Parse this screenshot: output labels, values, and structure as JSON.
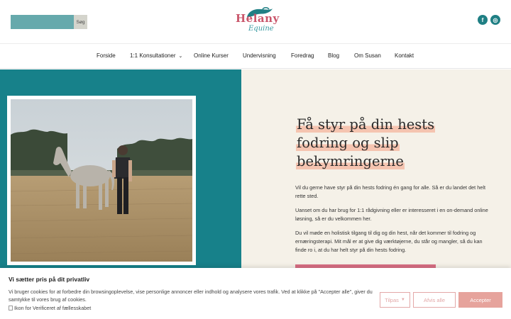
{
  "search": {
    "placeholder": "",
    "button_label": "Søg"
  },
  "logo": {
    "line1": "Helany",
    "line2": "Equine"
  },
  "social": [
    {
      "icon": "facebook-icon",
      "glyph": "f"
    },
    {
      "icon": "instagram-icon",
      "glyph": "◎"
    }
  ],
  "nav": {
    "items": [
      "Forside",
      "1:1 Konsultationer",
      "Online Kurser",
      "Undervisning",
      "Foredrag",
      "Blog",
      "Om Susan",
      "Kontakt"
    ]
  },
  "hero": {
    "title_lines": [
      "Få styr på din hests",
      "fodring og slip",
      "bekymringerne"
    ],
    "paragraphs": [
      "Vil du gerne have styr på din hests fodring én gang for alle. Så er du landet det helt rette sted.",
      "Uanset om du har brug for 1:1 rådgivning eller er interesseret i en on-demand online løsning, så er du velkommen her.",
      "Du vil møde en holistisk tilgang til dig og din hest, når det kommer til fodring og ernæringsterapi. Mit mål er at give dig værktøjerne, du står og mangler, så du kan finde ro i, at du har helt styr på din hests fodring."
    ]
  },
  "cookie": {
    "title": "Vi sætter pris på dit privatliv",
    "text": "Vi bruger cookies for at forbedre din browsingoplevelse, vise personlige annoncer eller indhold og analysere vores trafik. Ved at klikke på \"Accepter alle\", giver du samtykke til vores brug af cookies.",
    "image_alt": "Ikon for Verificeret af fællesskabet",
    "customize_label": "Tilpas",
    "reject_label": "Afvis alle",
    "accept_label": "Accepter"
  },
  "colors": {
    "teal": "#17818a",
    "cream": "#f5f1e8",
    "highlight": "#f5c4b0",
    "accent_pink": "#d86e83"
  }
}
